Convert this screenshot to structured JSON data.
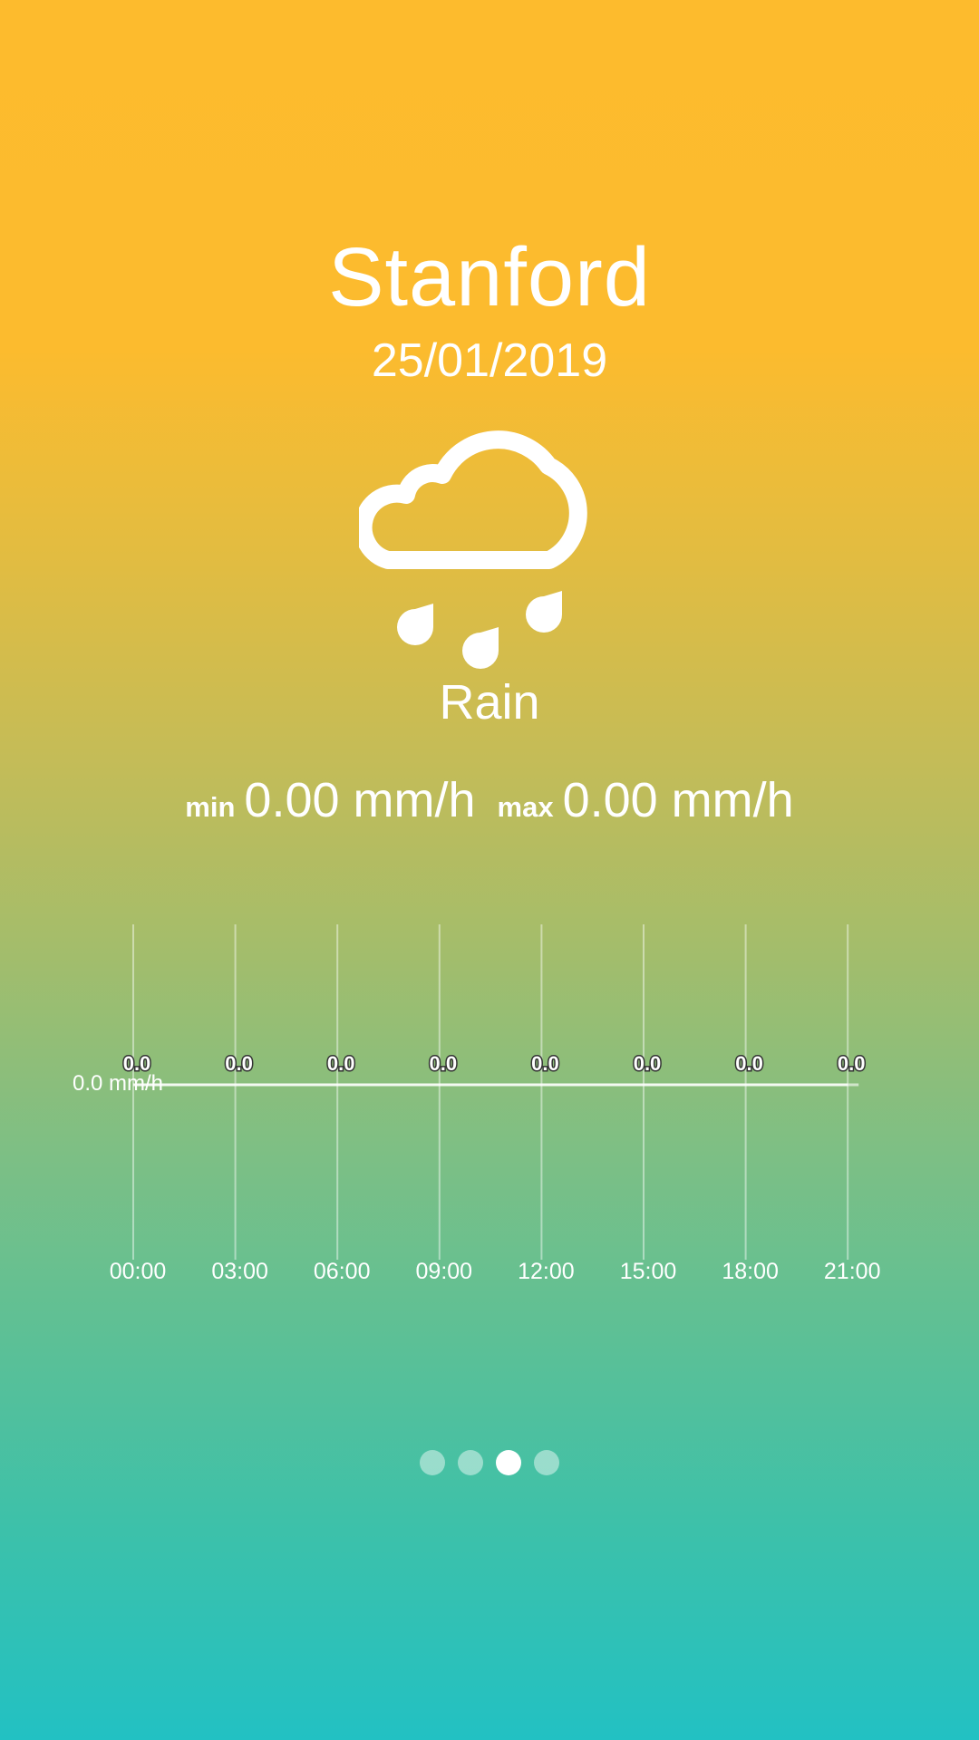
{
  "location": {
    "city": "Stanford",
    "date": "25/01/2019"
  },
  "weather": {
    "icon": "rain-cloud-icon",
    "condition": "Rain"
  },
  "range": {
    "min_label": "min",
    "min_value": "0.00 mm/h",
    "max_label": "max",
    "max_value": "0.00 mm/h"
  },
  "chart_data": {
    "type": "line",
    "x": [
      "00:00",
      "03:00",
      "06:00",
      "09:00",
      "12:00",
      "15:00",
      "18:00",
      "21:00"
    ],
    "series": [
      {
        "values": [
          0.0,
          0.0,
          0.0,
          0.0,
          0.0,
          0.0,
          0.0,
          0.0
        ],
        "data_labels": [
          "0.0",
          "0.0",
          "0.0",
          "0.0",
          "0.0",
          "0.0",
          "0.0",
          "0.0"
        ]
      }
    ],
    "y_tick_label": "0.0 mm/h",
    "grid": "vertical"
  },
  "pager": {
    "pages": 4,
    "active_index": 2
  },
  "colors": {
    "gradient_top": "#fdbb2d",
    "gradient_bottom": "#22c1c3",
    "foreground": "#ffffff"
  }
}
